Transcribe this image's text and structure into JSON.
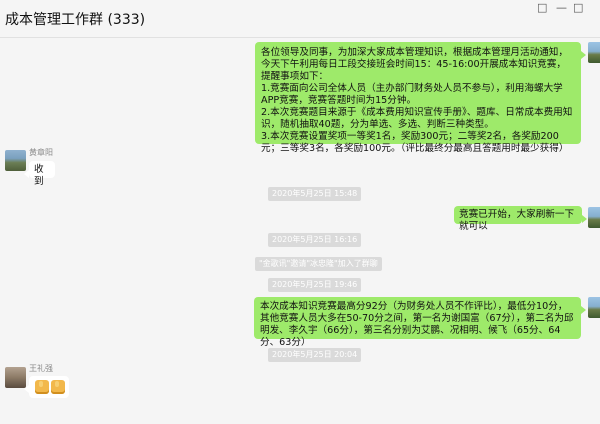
{
  "window": {
    "title": "成本管理工作群 (333)",
    "controls": {
      "pin_icon": "pin-icon",
      "minimize_icon": "minimize-icon",
      "maximize_icon": "maximize-icon"
    }
  },
  "messages": {
    "announcement": {
      "text": "各位领导及同事，为加深大家成本管理知识，根据成本管理月活动通知，今天下午利用每日工段交接班会时间15：45-16:00开展成本知识竞赛，提醒事项如下：\n1.竞赛面向公司全体人员（主办部门财务处人员不参与），利用海螺大学APP竞赛，竞赛答题时间为15分钟。\n2.本次竞赛题目来源于《成本费用知识宣传手册》、题库、日常成本费用知识，随机抽取40题，分为单选、多选、判断三种类型。\n3.本次竞赛设置奖项一等奖1名，奖励300元；二等奖2名，各奖励200元；三等奖3名，各奖励100元。（评比最终分最高且答题用时最少获得）"
    },
    "reply1": {
      "sender": "黄章阳",
      "text": "收到"
    },
    "time1": "2020年5月25日 15:48",
    "start": {
      "text": "竞赛已开始，大家刷新一下就可以"
    },
    "time2": "2020年5月25日 16:16",
    "system_join": "\"金歌讯\"邀请\"冰忠隆\"加入了群聊",
    "time3": "2020年5月25日 19:46",
    "results": {
      "text": "本次成本知识竞赛最高分92分（为财务处人员不作评比），最低分10分，其他竞赛人员大多在50-70分之间，第一名为谢国富（67分），第二名为邱明发、李久宇（66分），第三名分别为艾鹏、况相明、候飞（65分、64分、63分）"
    },
    "time4": "2020年5月25日 20:04",
    "reply2": {
      "sender": "王礼强",
      "emojis": [
        "thumbs-up-emoji",
        "thumbs-up-emoji"
      ]
    }
  }
}
